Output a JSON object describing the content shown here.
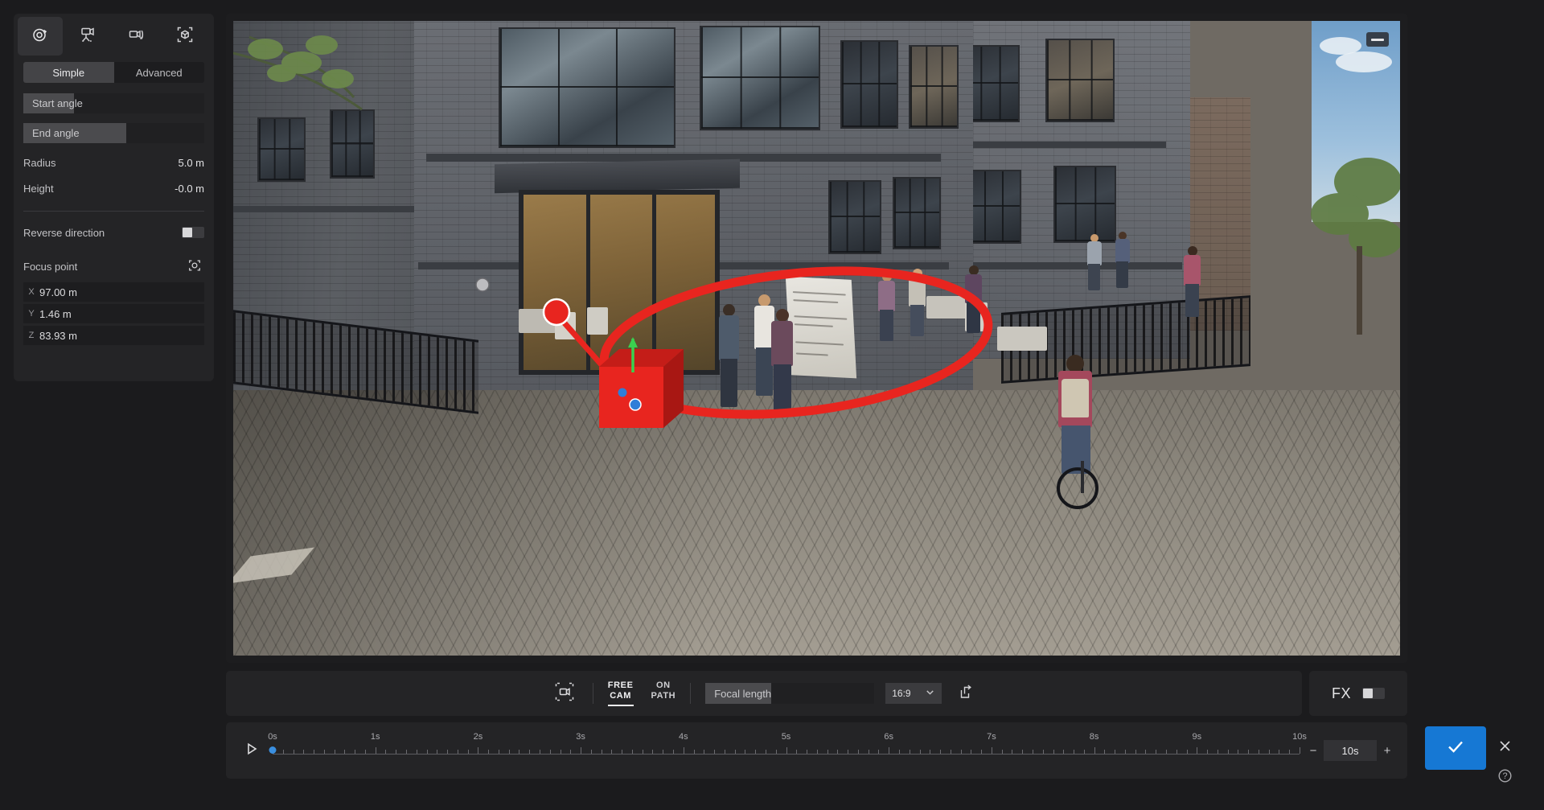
{
  "app": {
    "background_color": "#1b1b1d",
    "panel_color": "#242426",
    "accent_color": "#1678d4",
    "path_color": "#e8251f"
  },
  "left_panel": {
    "mode_tabs": [
      {
        "name": "orbit-camera-mode",
        "icon": "orbit-icon",
        "active": true
      },
      {
        "name": "tripod-camera-mode",
        "icon": "tripod-camera-icon",
        "active": false
      },
      {
        "name": "pan-camera-mode",
        "icon": "camera-rotate-icon",
        "active": false
      },
      {
        "name": "object-camera-mode",
        "icon": "bounding-box-cube-icon",
        "active": false
      }
    ],
    "segmented_tabs": [
      {
        "label": "Simple",
        "active": true
      },
      {
        "label": "Advanced",
        "active": false
      }
    ],
    "sliders": [
      {
        "label": "Start angle",
        "fill_percent": 28
      },
      {
        "label": "End angle",
        "fill_percent": 57
      }
    ],
    "numeric_fields": [
      {
        "label": "Radius",
        "value": "5.0 m"
      },
      {
        "label": "Height",
        "value": "-0.0 m"
      }
    ],
    "reverse_direction": {
      "label": "Reverse direction",
      "enabled": false
    },
    "focus_point": {
      "label": "Focus point",
      "target_icon": "crosshair-target-icon",
      "coords": [
        {
          "axis": "X",
          "value": "97.00 m"
        },
        {
          "axis": "Y",
          "value": "1.46 m"
        },
        {
          "axis": "Z",
          "value": "83.93 m"
        }
      ]
    }
  },
  "viewport": {
    "corner_button": "minimize-icon"
  },
  "bottom_toolbar": {
    "framing_button": "framing-guides-icon",
    "camera_modes": [
      {
        "line1": "FREE",
        "line2": "CAM",
        "active": true
      },
      {
        "line1": "ON",
        "line2": "PATH",
        "active": false
      }
    ],
    "focal_length": {
      "label": "Focal length",
      "fill_percent": 39
    },
    "aspect_ratio": {
      "value": "16:9",
      "chevron": "chevron-down-icon"
    },
    "export_button": "export-image-icon",
    "fx": {
      "label": "FX",
      "enabled": false
    }
  },
  "timeline": {
    "play_button": "play-icon",
    "ticks": [
      "0s",
      "1s",
      "2s",
      "3s",
      "4s",
      "5s",
      "6s",
      "7s",
      "8s",
      "9s",
      "10s"
    ],
    "playhead_seconds": 0,
    "duration": {
      "minus": "−",
      "value": "10s",
      "plus": "+"
    }
  },
  "actions": {
    "confirm": "checkmark-icon",
    "close": "close-icon",
    "help": "help-icon"
  }
}
